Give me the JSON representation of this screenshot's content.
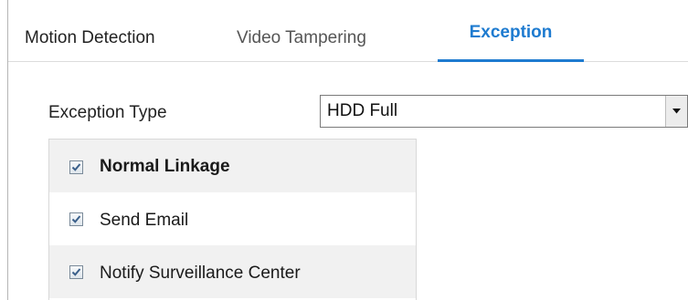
{
  "tabs": [
    {
      "label": "Motion Detection",
      "active": false
    },
    {
      "label": "Video Tampering",
      "active": false
    },
    {
      "label": "Exception",
      "active": true
    }
  ],
  "exception_type": {
    "label": "Exception Type",
    "selected": "HDD Full"
  },
  "linkage": {
    "normal_linkage": {
      "label": "Normal Linkage",
      "checked": true
    },
    "send_email": {
      "label": "Send Email",
      "checked": true
    },
    "notify_center": {
      "label": "Notify Surveillance Center",
      "checked": true
    }
  },
  "colors": {
    "accent": "#1e7bd0",
    "row_alt": "#f1f1f1"
  },
  "icons": {
    "dropdown": "caret-down-icon",
    "checkbox": "checkmark-icon"
  }
}
